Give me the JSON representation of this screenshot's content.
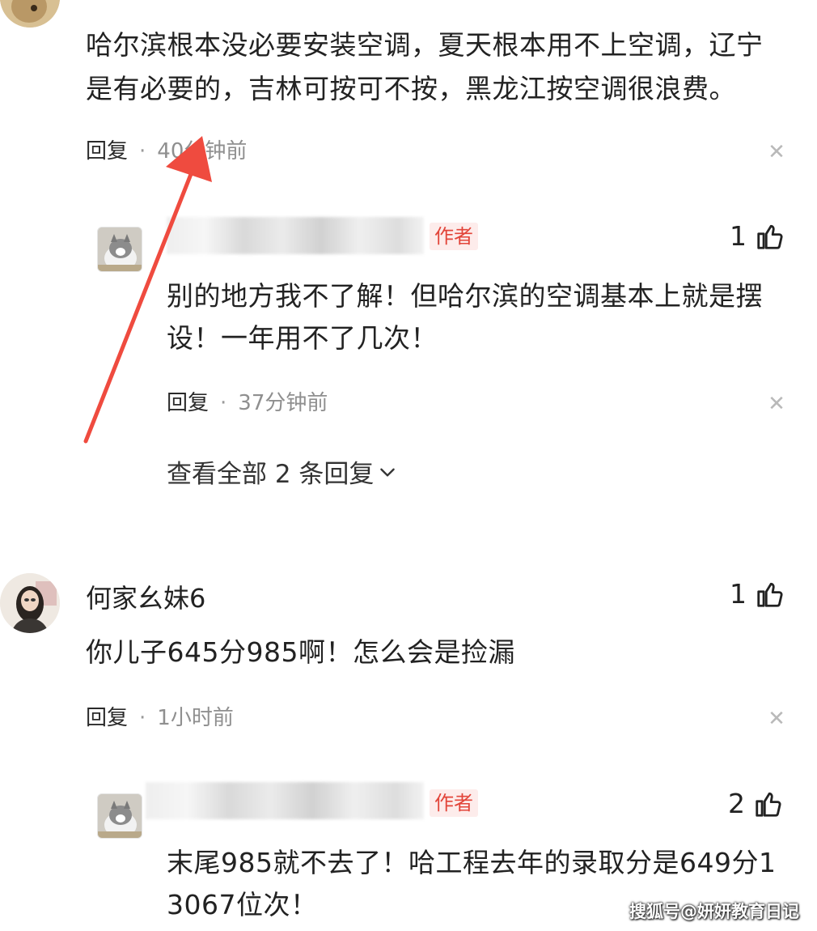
{
  "comment1": {
    "text_line1": "哈尔滨根本没必要安装空调，夏天根本用不上空调，辽宁",
    "text_line2": "是有必要的，吉林可按可不按，黑龙江按空调很浪费。",
    "reply_label": "回复",
    "time": "40分钟前"
  },
  "reply1": {
    "author_badge": "作者",
    "likes": "1",
    "text_line1": "别的地方我不了解！但哈尔滨的空调基本上就是摆",
    "text_line2": "设！一年用不了几次！",
    "reply_label": "回复",
    "time": "37分钟前"
  },
  "view_all_replies": "查看全部 2 条回复",
  "comment2": {
    "username": "何家幺妹6",
    "likes": "1",
    "text": "你儿子645分985啊！怎么会是捡漏",
    "reply_label": "回复",
    "time": "1小时前"
  },
  "reply2": {
    "author_badge": "作者",
    "likes": "2",
    "text_line1": "末尾985就不去了！哈工程去年的录取分是649分1",
    "text_line2": "3067位次！"
  },
  "watermark": "搜狐号@妍妍教育日记",
  "colors": {
    "arrow": "#ef4b3f",
    "author_badge": "#e2453a",
    "meta_time": "#8f8f8f"
  }
}
